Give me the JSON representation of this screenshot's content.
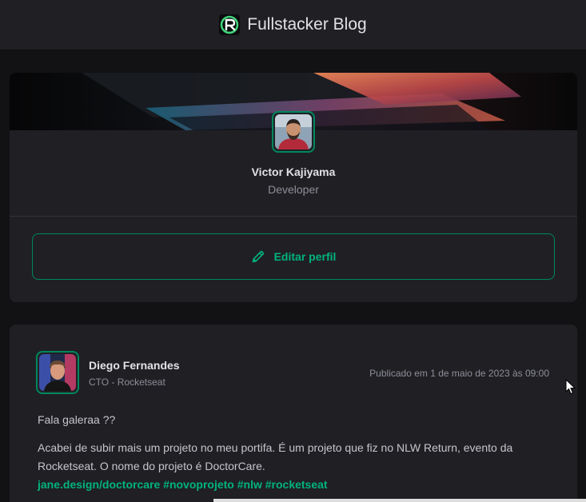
{
  "header": {
    "title": "Fullstacker Blog",
    "logo_icon": "rocketseat-logo-icon"
  },
  "profile": {
    "name": "Victor Kajiyama",
    "role": "Developer",
    "edit_label": "Editar perfil",
    "edit_icon": "pencil-icon"
  },
  "post": {
    "author": "Diego Fernandes",
    "author_role": "CTO - Rocketseat",
    "date": "Publicado em 1 de maio de 2023 às 09:00",
    "paragraph1": "Fala galeraa ??",
    "paragraph2": "Acabei de subir mais um projeto no meu portifa. É um projeto que fiz no NLW Return, evento da Rocketseat. O nome do projeto é DoctorCare.",
    "links": [
      "jane.design/doctorcare",
      "#novoprojeto",
      "#nlw",
      "#rocketseat"
    ]
  },
  "colors": {
    "accent": "#00875f",
    "accent_light": "#00b37e",
    "card": "#202024",
    "background": "#121214"
  }
}
